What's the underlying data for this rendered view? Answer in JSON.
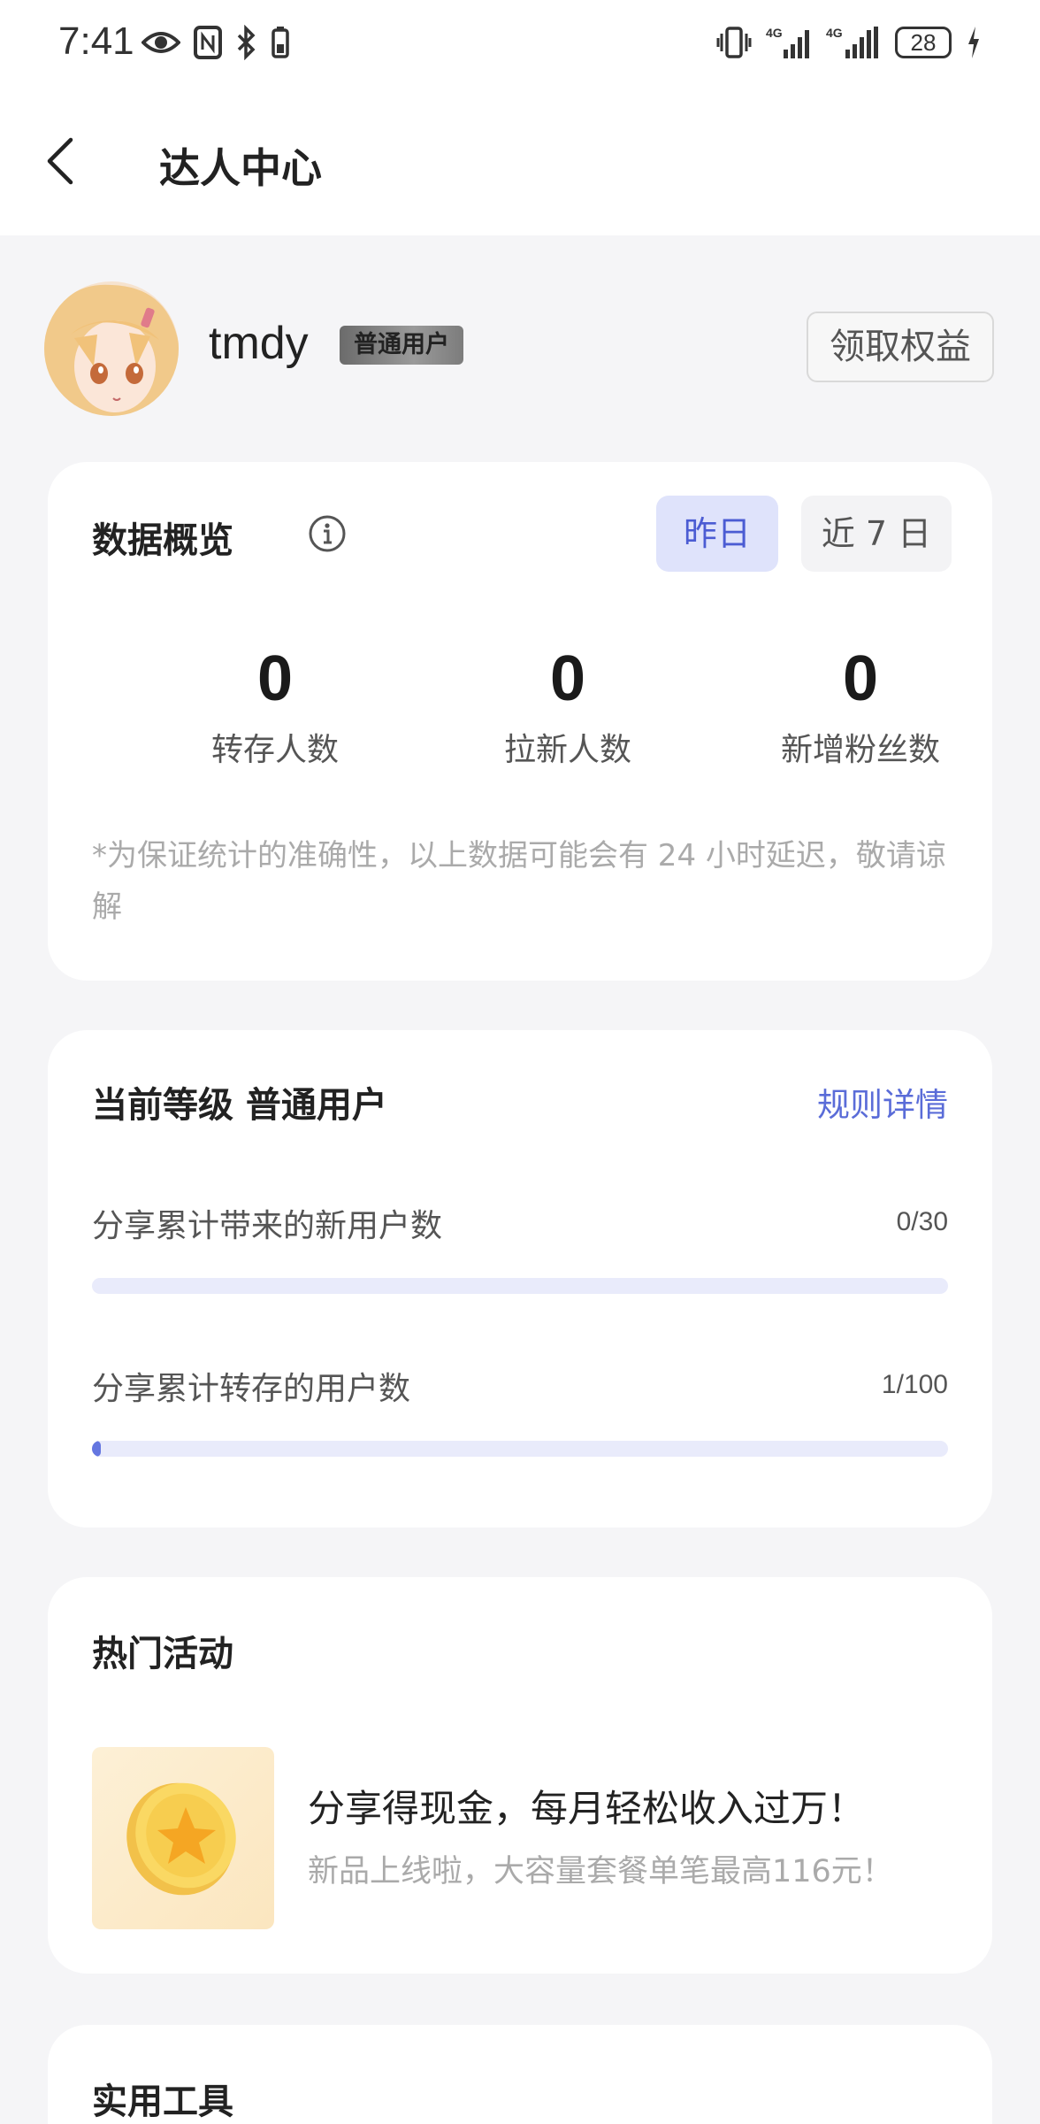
{
  "status_bar": {
    "time": "7:41",
    "battery": "28",
    "network": "4G",
    "icons": [
      "eye-icon",
      "nfc-icon",
      "bluetooth-icon",
      "vibrate-icon",
      "signal-icon",
      "battery-icon",
      "charging-icon"
    ]
  },
  "header": {
    "title": "达人中心",
    "back_icon": "back-arrow-icon"
  },
  "profile": {
    "username": "tmdy",
    "badge": "普通用户",
    "claim_button": "领取权益"
  },
  "overview": {
    "title": "数据概览",
    "tabs": [
      {
        "label": "昨日",
        "active": true
      },
      {
        "label": "近 7 日",
        "active": false
      }
    ],
    "stats": [
      {
        "value": "0",
        "label": "转存人数"
      },
      {
        "value": "0",
        "label": "拉新人数"
      },
      {
        "value": "0",
        "label": "新增粉丝数"
      }
    ],
    "note": "*为保证统计的准确性，以上数据可能会有 24 小时延迟，敬请谅解"
  },
  "level": {
    "title": "当前等级 普通用户",
    "rules_link": "规则详情",
    "progress": [
      {
        "label": "分享累计带来的新用户数",
        "count": "0/30",
        "fraction": 0.0
      },
      {
        "label": "分享累计转存的用户数",
        "count": "1/100",
        "fraction": 0.01
      }
    ]
  },
  "activities": {
    "title": "热门活动",
    "items": [
      {
        "title": "分享得现金，每月轻松收入过万！",
        "subtitle": "新品上线啦，大容量套餐单笔最高116元！",
        "icon": "gold-coin-icon"
      }
    ]
  },
  "tools": {
    "title": "实用工具"
  },
  "colors": {
    "accent": "#5a6cd8",
    "progress_track": "#e9ebfb",
    "progress_fill": "#6476e0",
    "active_tab_bg": "#dfe3fb",
    "page_bg": "#f5f5f7"
  }
}
